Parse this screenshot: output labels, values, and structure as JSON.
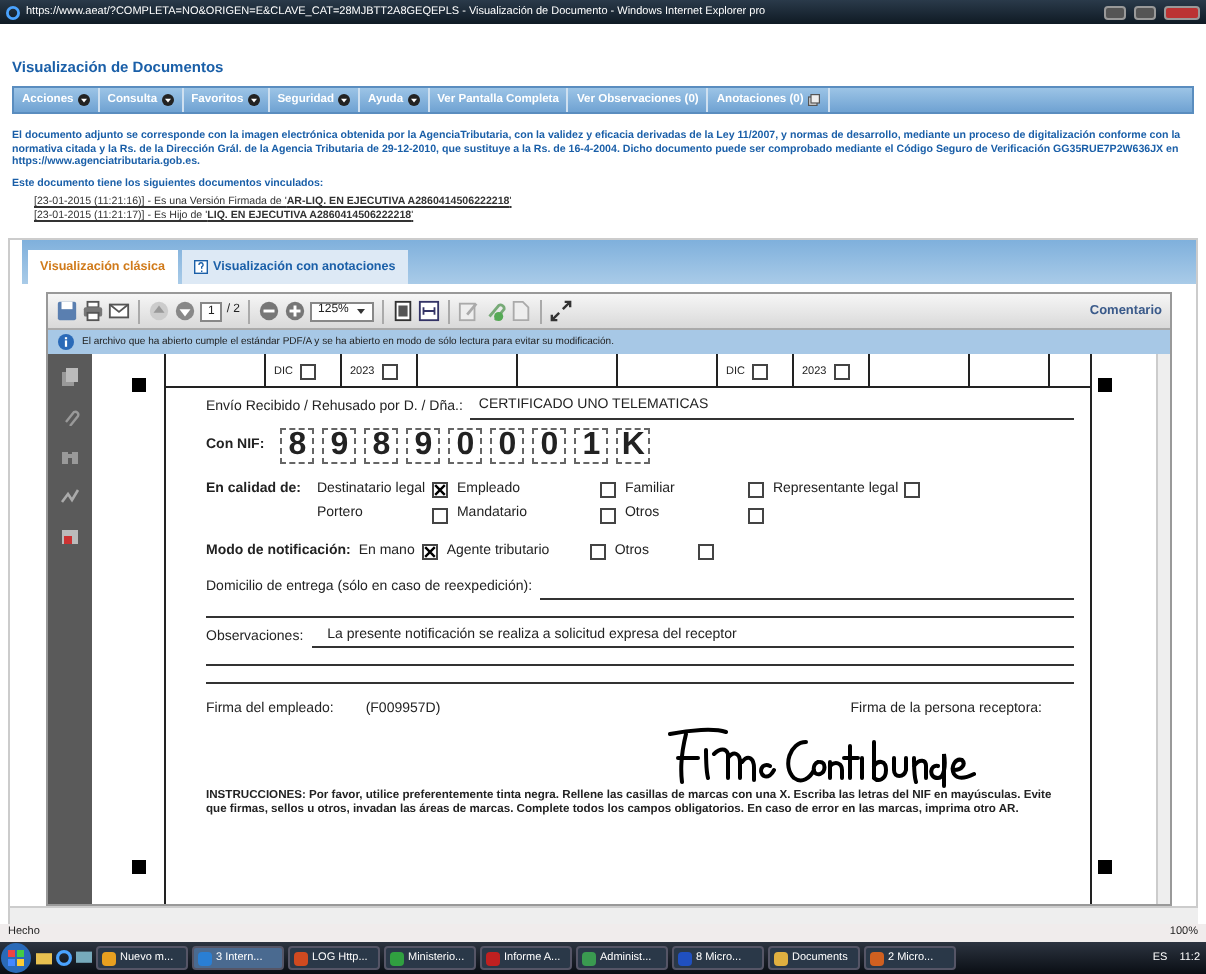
{
  "window": {
    "title": "https://www.aeat/?COMPLETA=NO&ORIGEN=E&CLAVE_CAT=28MJBTT2A8GEQEPLS - Visualización de Documento - Windows Internet Explorer pro"
  },
  "page_title": "Visualización de Documentos",
  "menu": [
    {
      "label": "Acciones",
      "kind": "dropdown"
    },
    {
      "label": "Consulta",
      "kind": "dropdown"
    },
    {
      "label": "Favoritos",
      "kind": "dropdown"
    },
    {
      "label": "Seguridad",
      "kind": "dropdown"
    },
    {
      "label": "Ayuda",
      "kind": "dropdown"
    },
    {
      "label": "Ver Pantalla Completa",
      "kind": "plain"
    },
    {
      "label": "Ver Observaciones (0)",
      "kind": "plain"
    },
    {
      "label": "Anotaciones (0)",
      "kind": "popup"
    }
  ],
  "notice": "El documento adjunto se corresponde con la imagen electrónica obtenida por la AgenciaTributaria, con la validez y eficacia derivadas de la Ley 11/2007, y normas de desarrollo, mediante un proceso de digitalización conforme con la normativa citada y la Rs. de la Dirección Grál. de la Agencia Tributaria de 29-12-2010, que sustituye a la Rs. de 16-4-2004. Dicho documento puede ser comprobado mediante el Código Seguro de Verificación GG35RUE7P2W636JX en https://www.agenciatributaria.gob.es.",
  "linked": {
    "heading": "Este documento tiene los siguientes documentos vinculados:",
    "items": [
      "[23-01-2015 (11:21:16)] - Es una Versión Firmada de '**AR-LIQ. EN EJECUTIVA A2860414506222218**'",
      "[23-01-2015 (11:21:17)] - Es Hijo de '**LIQ. EN EJECUTIVA A2860414506222218**'"
    ]
  },
  "tabs": [
    {
      "label": "Visualización clásica",
      "selected": true,
      "kind": "plain"
    },
    {
      "label": "Visualización con anotaciones",
      "selected": false,
      "kind": "help"
    }
  ],
  "toolbar": {
    "page": "1",
    "pages": "/ 2",
    "zoom": "125%",
    "comment": "Comentario"
  },
  "banner": "El archivo que ha abierto cumple el estándar PDF/A y se ha abierto en modo de sólo lectura para evitar su modificación.",
  "form": {
    "calendar": [
      [
        {
          "label": "DIC",
          "checked": false
        },
        {
          "label": "2023",
          "checked": false
        }
      ],
      [
        {
          "label": "DIC",
          "checked": false
        },
        {
          "label": "2023",
          "checked": false
        }
      ]
    ],
    "sender_label": "Envío Recibido / Rehusado por D. / Dña.:",
    "sender_value": "CERTIFICADO UNO TELEMATICAS",
    "nif_label": "Con NIF:",
    "nif_digits": [
      "8",
      "9",
      "8",
      "9",
      "0",
      "0",
      "0",
      "1",
      "K"
    ],
    "capacity_label": "En calidad de:",
    "capacity_options": [
      {
        "label": "Destinatario legal",
        "checked": true
      },
      {
        "label": "Empleado",
        "checked": false
      },
      {
        "label": "Familiar",
        "checked": false
      },
      {
        "label": "Representante legal",
        "checked": false
      },
      {
        "label": "Portero",
        "checked": false
      },
      {
        "label": "Mandatario",
        "checked": false
      },
      {
        "label": "Otros",
        "checked": false
      }
    ],
    "mode_label": "Modo de notificación:",
    "mode_options": [
      {
        "label": "En mano",
        "checked": true
      },
      {
        "label": "Agente tributario",
        "checked": false
      },
      {
        "label": "Otros",
        "checked": false
      }
    ],
    "domicile_label": "Domicilio de entrega (sólo en caso de reexpedición):",
    "observations_label": "Observaciones:",
    "observations_value": "La presente notificación se realiza a solicitud expresa del receptor",
    "employee_label": "Firma del empleado:",
    "employee_id": "(F009957D)",
    "receiver_label": "Firma de la persona receptora:",
    "instructions": "INSTRUCCIONES: Por favor, utilice preferentemente tinta negra. Rellene las casillas de marcas con una X. Escriba las letras del NIF en mayúsculas. Evite que firmas, sellos u otros, invadan las áreas de marcas. Complete todos los campos obligatorios. En caso de error en las marcas, imprima otro AR."
  },
  "status_bar": {
    "text": "Hecho",
    "zoom": "100%"
  },
  "taskbar": {
    "items": [
      {
        "label": "Nuevo m...",
        "selected": false,
        "color": "#e8a020"
      },
      {
        "label": "3 Intern...",
        "selected": true,
        "color": "#2a7fd4"
      },
      {
        "label": "LOG Http...",
        "selected": false,
        "color": "#d04a20"
      },
      {
        "label": "Ministerio...",
        "selected": false,
        "color": "#30a040"
      },
      {
        "label": "Informe A...",
        "selected": false,
        "color": "#c02020"
      },
      {
        "label": "Administ...",
        "selected": false,
        "color": "#3a9a50"
      },
      {
        "label": "8 Micro...",
        "selected": false,
        "color": "#2050c0"
      },
      {
        "label": "Documents",
        "selected": false,
        "color": "#e0b040"
      },
      {
        "label": "2 Micro...",
        "selected": false,
        "color": "#d06020"
      }
    ],
    "language": "ES",
    "clock": "11:2"
  }
}
